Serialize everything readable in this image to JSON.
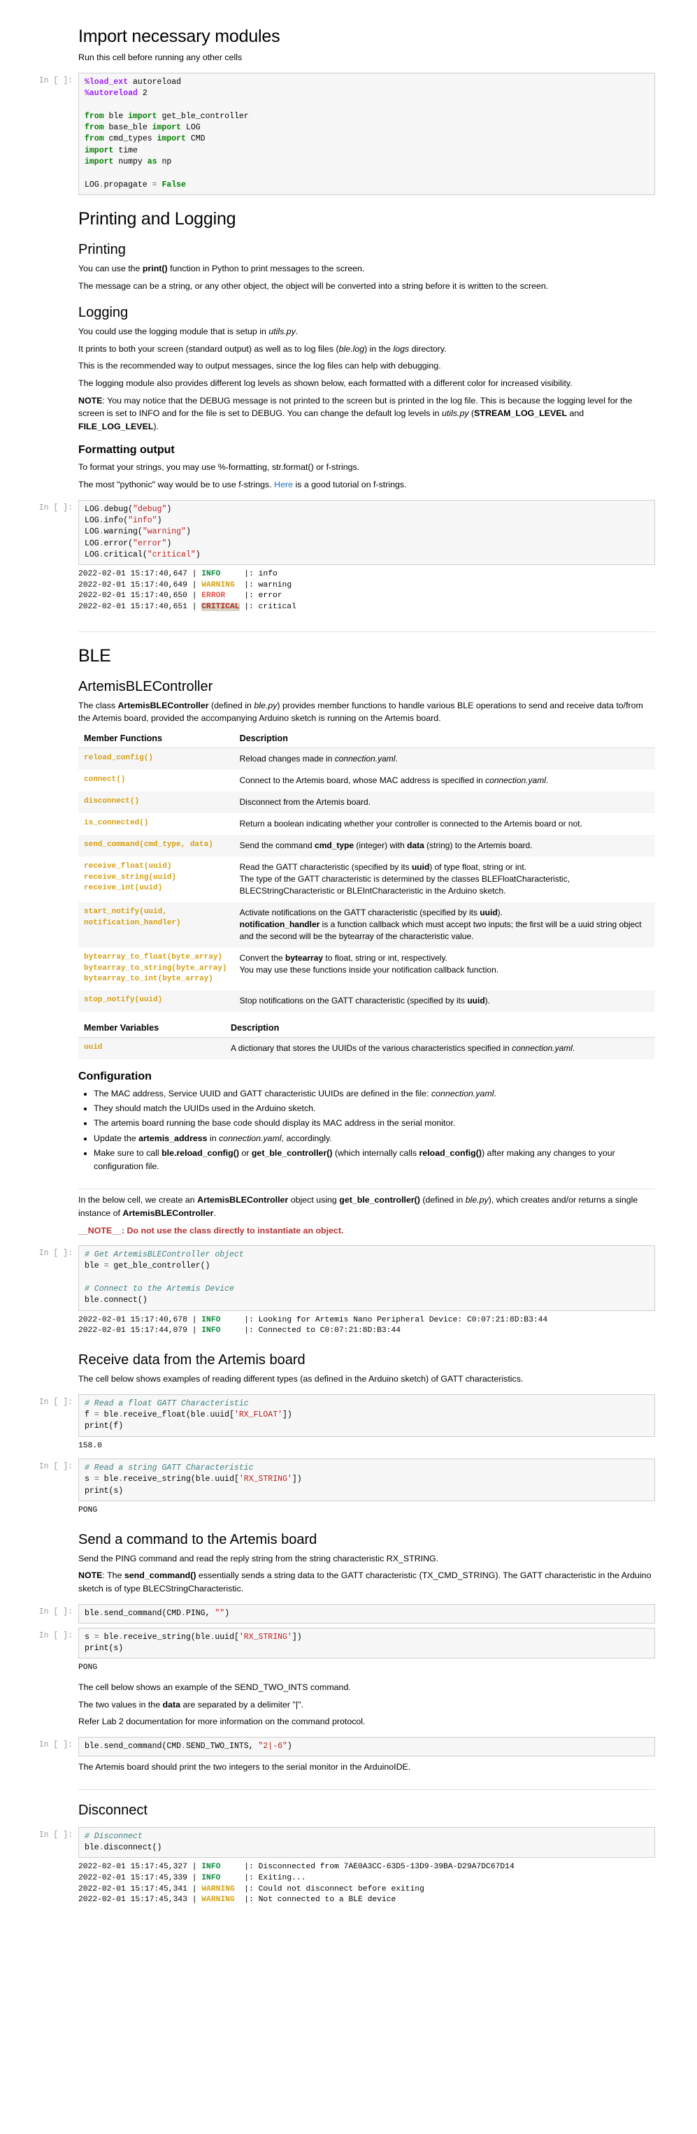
{
  "prompts": {
    "empty": "In [ ]:",
    "blank": ""
  },
  "sections": {
    "import": {
      "heading": "Import necessary modules",
      "subtitle": "Run this cell before running any other cells",
      "code_lines": [
        "%load_ext autoreload",
        "%autoreload 2",
        "",
        "from ble import get_ble_controller",
        "from base_ble import LOG",
        "from cmd_types import CMD",
        "import time",
        "import numpy as np",
        "",
        "LOG.propagate = False"
      ]
    },
    "printing_logging": {
      "heading": "Printing and Logging",
      "printing": {
        "heading": "Printing",
        "p1_a": "You can use the ",
        "p1_code": "print()",
        "p1_b": " function in Python to print messages to the screen.",
        "p2": "The message can be a string, or any other object, the object will be converted into a string before it is written to the screen."
      },
      "logging": {
        "heading": "Logging",
        "p1_a": "You could use the logging module that is setup in ",
        "p1_em": "utils.py",
        "p1_b": ".",
        "p2_a": "It prints to both your screen (standard output) as well as to log files (",
        "p2_em1": "ble.log",
        "p2_b": ") in the ",
        "p2_em2": "logs",
        "p2_c": " directory.",
        "p3": "This is the recommended way to output messages, since the log files can help with debugging.",
        "p4": "The logging module also provides different log levels as shown below, each formatted with a different color for increased visibility.",
        "note_label": "NOTE",
        "note_a": ": You may notice that the DEBUG message is not printed to the screen but is printed in the log file. This is because the logging level for the screen is set to INFO and for the file is set to DEBUG. You can change the default log levels in ",
        "note_em": "utils.py",
        "note_b": " (",
        "note_bold": "STREAM_LOG_LEVEL",
        "note_c": " and ",
        "note_bold2": "FILE_LOG_LEVEL",
        "note_d": ")."
      },
      "formatting": {
        "heading": "Formatting output",
        "p1": "To format your strings, you may use %-formatting, str.format() or f-strings.",
        "p2_a": "The most \"pythonic\" way would be to use f-strings. ",
        "p2_link": "Here",
        "p2_b": " is a good tutorial on f-strings.",
        "code_lines": [
          "LOG.debug(\"debug\")",
          "LOG.info(\"info\")",
          "LOG.warning(\"warning\")",
          "LOG.error(\"error\")",
          "LOG.critical(\"critical\")"
        ],
        "log_output": [
          {
            "ts": "2022-02-01 15:17:40,647",
            "level": "INFO",
            "pad": "    ",
            "msg": ": info"
          },
          {
            "ts": "2022-02-01 15:17:40,649",
            "level": "WARNING",
            "pad": " ",
            "msg": ": warning"
          },
          {
            "ts": "2022-02-01 15:17:40,650",
            "level": "ERROR",
            "pad": "   ",
            "msg": ": error"
          },
          {
            "ts": "2022-02-01 15:17:40,651",
            "level": "CRITICAL",
            "pad": "",
            "msg": ": critical"
          }
        ]
      }
    },
    "ble": {
      "heading": "BLE",
      "controller": {
        "heading": "ArtemisBLEController",
        "intro_a": "The class ",
        "intro_bold": "ArtemisBLEController",
        "intro_b": " (defined in ",
        "intro_em": "ble.py",
        "intro_c": ") provides member functions to handle various BLE operations to send and receive data to/from the Artemis board, provided the accompanying Arduino sketch is running on the Artemis board.",
        "table_headers": [
          "Member Functions",
          "Description"
        ],
        "rows": [
          {
            "fn": "reload_config()",
            "desc_parts": [
              {
                "t": "Reload changes made in ",
                "s": "plain"
              },
              {
                "t": "connection.yaml",
                "s": "em"
              },
              {
                "t": ".",
                "s": "plain"
              }
            ]
          },
          {
            "fn": "connect()",
            "desc_parts": [
              {
                "t": "Connect to the Artemis board, whose MAC address is specified in ",
                "s": "plain"
              },
              {
                "t": "connection.yaml",
                "s": "em"
              },
              {
                "t": ".",
                "s": "plain"
              }
            ]
          },
          {
            "fn": "disconnect()",
            "desc_parts": [
              {
                "t": "Disconnect from the Artemis board.",
                "s": "plain"
              }
            ]
          },
          {
            "fn": "is_connected()",
            "desc_parts": [
              {
                "t": "Return a boolean indicating whether your controller is connected to the Artemis board or not.",
                "s": "plain"
              }
            ]
          },
          {
            "fn": "send_command(cmd_type, data)",
            "desc_parts": [
              {
                "t": "Send the command ",
                "s": "plain"
              },
              {
                "t": "cmd_type",
                "s": "b"
              },
              {
                "t": " (integer) with ",
                "s": "plain"
              },
              {
                "t": "data",
                "s": "b"
              },
              {
                "t": " (string) to the Artemis board.",
                "s": "plain"
              }
            ]
          },
          {
            "fn": "receive_float(uuid)\nreceive_string(uuid)\nreceive_int(uuid)",
            "desc_parts": [
              {
                "t": "Read the GATT characteristic (specified by its ",
                "s": "plain"
              },
              {
                "t": "uuid",
                "s": "b"
              },
              {
                "t": ") of type float, string or int.",
                "s": "plain"
              },
              {
                "t": "\n",
                "s": "br"
              },
              {
                "t": "The type of the GATT characteristic is determined by the classes BLEFloatCharacteristic, BLECStringCharacteristic or BLEIntCharacteristic in the Arduino sketch.",
                "s": "plain"
              }
            ]
          },
          {
            "fn": "start_notify(uuid,\nnotification_handler)",
            "desc_parts": [
              {
                "t": "Activate notifications on the GATT characteristic (specified by its ",
                "s": "plain"
              },
              {
                "t": "uuid",
                "s": "b"
              },
              {
                "t": ").",
                "s": "plain"
              },
              {
                "t": "\n",
                "s": "br"
              },
              {
                "t": "notification_handler",
                "s": "b"
              },
              {
                "t": " is a function callback which must accept two inputs; the first will be a uuid string object and the second will be the bytearray of the characteristic value.",
                "s": "plain"
              }
            ]
          },
          {
            "fn": "bytearray_to_float(byte_array)\nbytearray_to_string(byte_array)\nbytearray_to_int(byte_array)",
            "desc_parts": [
              {
                "t": "Convert the ",
                "s": "plain"
              },
              {
                "t": "bytearray",
                "s": "b"
              },
              {
                "t": " to float, string or int, respectively.",
                "s": "plain"
              },
              {
                "t": "\n",
                "s": "br"
              },
              {
                "t": "You may use these functions inside your notification callback function.",
                "s": "plain"
              }
            ]
          },
          {
            "fn": "stop_notify(uuid)",
            "desc_parts": [
              {
                "t": "Stop notifications on the GATT characteristic (specified by its ",
                "s": "plain"
              },
              {
                "t": "uuid",
                "s": "b"
              },
              {
                "t": ").",
                "s": "plain"
              }
            ]
          }
        ],
        "vars_headers": [
          "Member Variables",
          "Description"
        ],
        "vars_rows": [
          {
            "fn": "uuid",
            "desc_parts": [
              {
                "t": "A dictionary that stores the UUIDs of the various characteristics specified in ",
                "s": "plain"
              },
              {
                "t": "connection.yaml",
                "s": "em"
              },
              {
                "t": ".",
                "s": "plain"
              }
            ]
          }
        ]
      },
      "configuration": {
        "heading": "Configuration",
        "bullets": [
          [
            {
              "t": "The MAC address, Service UUID and GATT characteristic UUIDs are defined in the file: ",
              "s": "plain"
            },
            {
              "t": "connection.yaml",
              "s": "em"
            },
            {
              "t": ".",
              "s": "plain"
            }
          ],
          [
            {
              "t": "They should match the UUIDs used in the Arduino sketch.",
              "s": "plain"
            }
          ],
          [
            {
              "t": "The artemis board running the base code should display its MAC address in the serial monitor.",
              "s": "plain"
            }
          ],
          [
            {
              "t": "Update the ",
              "s": "plain"
            },
            {
              "t": "artemis_address",
              "s": "b"
            },
            {
              "t": " in ",
              "s": "plain"
            },
            {
              "t": "connection.yaml",
              "s": "em"
            },
            {
              "t": ", accordingly.",
              "s": "plain"
            }
          ],
          [
            {
              "t": "Make sure to call ",
              "s": "plain"
            },
            {
              "t": "ble.reload_config()",
              "s": "b"
            },
            {
              "t": " or ",
              "s": "plain"
            },
            {
              "t": "get_ble_controller()",
              "s": "b"
            },
            {
              "t": " (which internally calls ",
              "s": "plain"
            },
            {
              "t": "reload_config()",
              "s": "b"
            },
            {
              "t": ") after making any changes to your configuration file.",
              "s": "plain"
            }
          ]
        ],
        "para_a": "In the below cell, we create an ",
        "para_bold": "ArtemisBLEController",
        "para_b": " object using ",
        "para_bold2": "get_ble_controller()",
        "para_c": " (defined in ",
        "para_em": "ble.py",
        "para_d": "), which creates and/or returns a single instance of ",
        "para_bold3": "ArtemisBLEController",
        "para_e": ".",
        "note": "__NOTE__: Do not use the class directly to instantiate an object.",
        "code_lines": [
          "# Get ArtemisBLEController object",
          "ble = get_ble_controller()",
          "",
          "# Connect to the Artemis Device",
          "ble.connect()"
        ],
        "log_output": [
          {
            "ts": "2022-02-01 15:17:40,678",
            "level": "INFO",
            "pad": "    ",
            "msg": ": Looking for Artemis Nano Peripheral Device: C0:07:21:8D:B3:44"
          },
          {
            "ts": "2022-02-01 15:17:44,079",
            "level": "INFO",
            "pad": "    ",
            "msg": ": Connected to C0:07:21:8D:B3:44"
          }
        ]
      },
      "receive": {
        "heading": "Receive data from the Artemis board",
        "p1": "The cell below shows examples of reading different types (as defined in the Arduino sketch) of GATT characteristics.",
        "code_lines_float": [
          "# Read a float GATT Characteristic",
          "f = ble.receive_float(ble.uuid['RX_FLOAT'])",
          "print(f)"
        ],
        "output_float": "158.0",
        "code_lines_string": [
          "# Read a string GATT Characteristic",
          "s = ble.receive_string(ble.uuid['RX_STRING'])",
          "print(s)"
        ],
        "output_string": "PONG"
      },
      "send": {
        "heading": "Send a command to the Artemis board",
        "p1": "Send the PING command and read the reply string from the string characteristic RX_STRING.",
        "p2_label": "NOTE",
        "p2_a": ": The ",
        "p2_bold": "send_command()",
        "p2_b": " essentially sends a string data to the GATT characteristic (TX_CMD_STRING). The GATT characteristic in the Arduino sketch is of type BLECStringCharacteristic.",
        "code_ping": [
          "ble.send_command(CMD.PING, \"\")"
        ],
        "code_recv": [
          "s = ble.receive_string(ble.uuid['RX_STRING'])",
          "print(s)"
        ],
        "output_recv": "PONG",
        "p3": "The cell below shows an example of the SEND_TWO_INTS command.",
        "p4_a": "The two values in the ",
        "p4_bold": "data",
        "p4_b": " are separated by a delimiter \"|\".",
        "p5": "Refer Lab 2 documentation for more information on the command protocol.",
        "code_two_ints": [
          "ble.send_command(CMD.SEND_TWO_INTS, \"2|-6\")"
        ],
        "p6": "The Artemis board should print the two integers to the serial monitor in the ArduinoIDE."
      },
      "disconnect": {
        "heading": "Disconnect",
        "code_lines": [
          "# Disconnect",
          "ble.disconnect()"
        ],
        "log_output": [
          {
            "ts": "2022-02-01 15:17:45,327",
            "level": "INFO",
            "pad": "    ",
            "msg": ": Disconnected from 7AE0A3CC-63D5-13D9-39BA-D29A7DC67D14"
          },
          {
            "ts": "2022-02-01 15:17:45,339",
            "level": "INFO",
            "pad": "    ",
            "msg": ": Exiting..."
          },
          {
            "ts": "2022-02-01 15:17:45,341",
            "level": "WARNING",
            "pad": " ",
            "msg": ": Could not disconnect before exiting"
          },
          {
            "ts": "2022-02-01 15:17:45,343",
            "level": "WARNING",
            "pad": " ",
            "msg": ": Not connected to a BLE device"
          }
        ]
      }
    }
  }
}
